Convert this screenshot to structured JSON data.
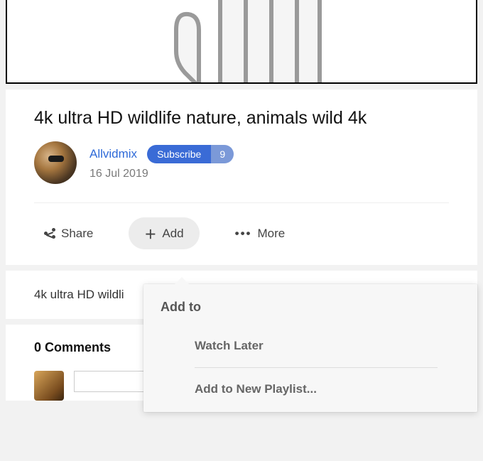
{
  "video": {
    "title": "4k ultra HD wildlife nature, animals wild 4k",
    "description_preview": "4k ultra HD wildli"
  },
  "channel": {
    "name": "Allvidmix",
    "upload_date": "16 Jul 2019"
  },
  "subscribe": {
    "label": "Subscribe",
    "count": "9"
  },
  "actions": {
    "share": "Share",
    "add": "Add",
    "more": "More"
  },
  "dropdown": {
    "title": "Add to",
    "items": [
      "Watch Later",
      "Add to New Playlist..."
    ]
  },
  "comments": {
    "header": "0 Comments"
  }
}
